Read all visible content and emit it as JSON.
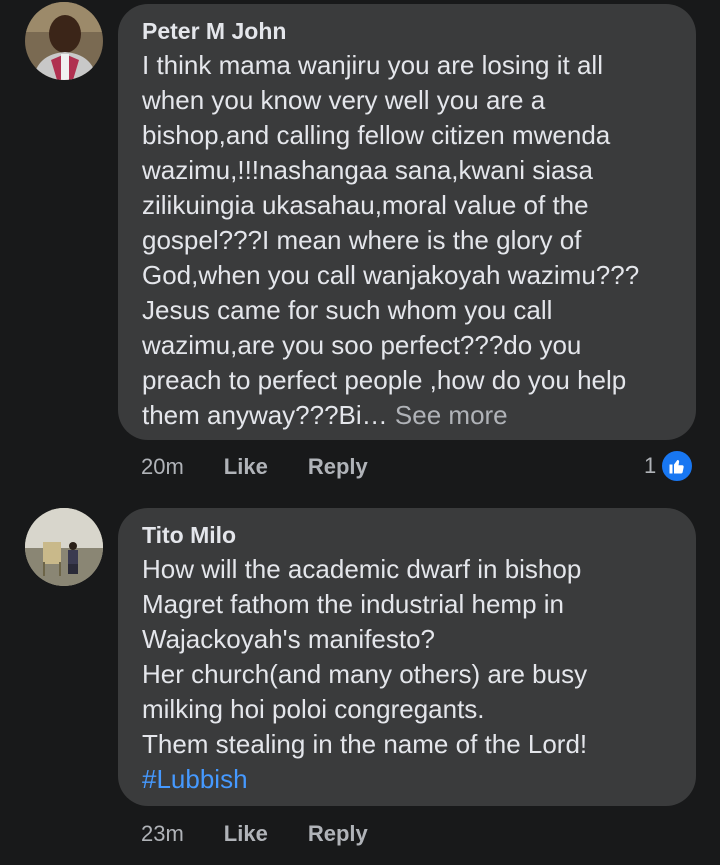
{
  "comments": [
    {
      "author": "Peter M John",
      "text": "I think mama wanjiru you are losing it all\nwhen you know very well you are a\nbishop,and calling fellow citizen mwenda\nwazimu,!!!nashangaa sana,kwani siasa\nzilikuingia ukasahau,moral value of the\ngospel???I mean where is the glory of\nGod,when you call wanjakoyah wazimu???\nJesus came for such whom you call\nwazimu,are you soo perfect???do you\npreach to perfect people ,how do you help\nthem anyway???Bi…",
      "see_more": "See more",
      "time": "20m",
      "like": "Like",
      "reply": "Reply",
      "reaction_count": "1",
      "avatar_icon": "user-avatar-icon"
    },
    {
      "author": "Tito Milo",
      "text": "How will the academic dwarf in bishop\nMagret fathom the industrial hemp in\nWajackoyah's manifesto?\nHer church(and many others) are busy\nmilking hoi poloi congregants.\nThem stealing in the name of the Lord!",
      "hashtag": "#Lubbish",
      "time": "23m",
      "like": "Like",
      "reply": "Reply",
      "avatar_icon": "user-avatar-icon"
    }
  ],
  "colors": {
    "background": "#18191a",
    "bubble": "#3a3b3c",
    "text": "#e4e6eb",
    "muted": "#b0b3b8",
    "link": "#4599ff",
    "like_blue": "#1877f2"
  }
}
